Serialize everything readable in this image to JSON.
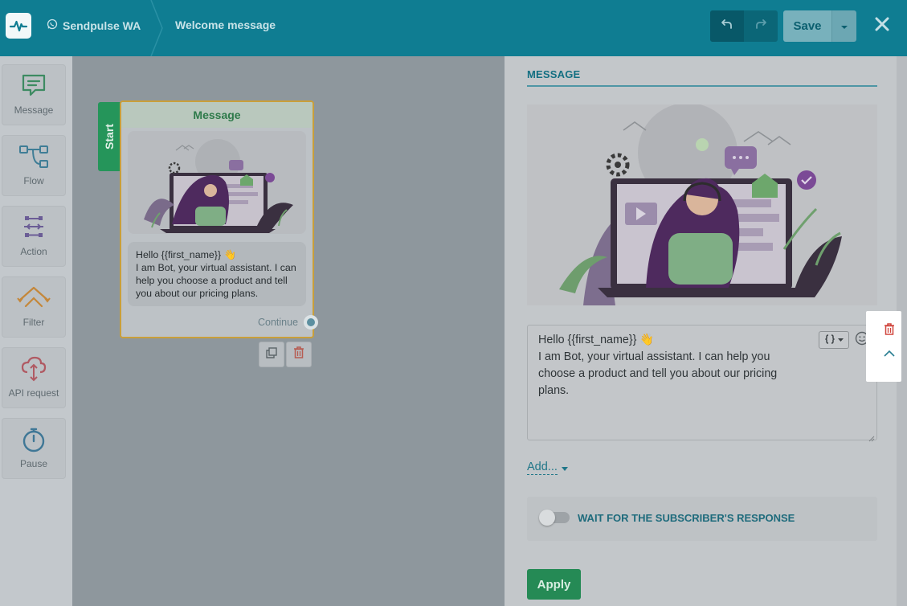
{
  "header": {
    "bot_name": "Sendpulse WA",
    "bot_channel_icon": "whatsapp-icon",
    "page_title": "Welcome message",
    "save_label": "Save",
    "colors": {
      "bar": "#0f7d92",
      "save": "#78b1bc"
    }
  },
  "sidebar": {
    "items": [
      {
        "label": "Message",
        "icon": "message-icon",
        "color": "#3d8b62"
      },
      {
        "label": "Flow",
        "icon": "flow-icon",
        "color": "#3f7d96"
      },
      {
        "label": "Action",
        "icon": "action-icon",
        "color": "#6b5d96"
      },
      {
        "label": "Filter",
        "icon": "filter-icon",
        "color": "#c4873a"
      },
      {
        "label": "API request",
        "icon": "api-request-icon",
        "color": "#b05a63"
      },
      {
        "label": "Pause",
        "icon": "pause-icon",
        "color": "#3f7796"
      }
    ]
  },
  "canvas": {
    "start_label": "Start",
    "node": {
      "title": "Message",
      "text_line1": "Hello {{first_name}} 👋",
      "text_line2": "I am Bot, your virtual assistant. I can help you choose a product and tell you about our pricing plans.",
      "continue_label": "Continue"
    }
  },
  "panel": {
    "title": "MESSAGE",
    "message_line1": "Hello {{first_name}} 👋",
    "message_line2": "I am Bot, your virtual assistant. I can help you choose a product and tell you about our pricing plans.",
    "add_label": "Add...",
    "wait_label": "WAIT FOR THE SUBSCRIBER'S RESPONSE",
    "wait_enabled": false,
    "apply_label": "Apply",
    "colors": {
      "apply": "#258a55",
      "accent": "#136f82",
      "delete": "#c0392b"
    }
  }
}
